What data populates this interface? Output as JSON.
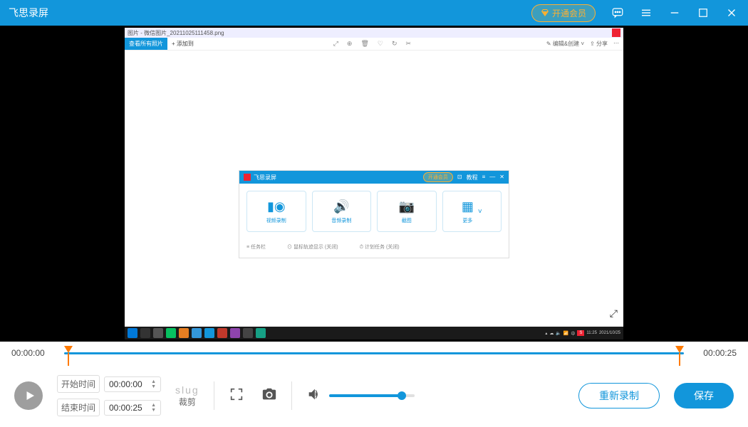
{
  "titlebar": {
    "title": "飞思录屏",
    "vip_label": "开通会员"
  },
  "video": {
    "file_title": "图片 - 微信图片_20211025111458.png",
    "tab1": "查看所有照片",
    "tab2": "+ 添加到",
    "right1": "编辑&创建",
    "right2": "分享",
    "taskbar": {
      "time": "11:25",
      "date": "2021/10/25"
    },
    "inner_app": {
      "title": "飞思录屏",
      "vip": "开通会员",
      "extra": "教程",
      "cards": {
        "c1": "视频录制",
        "c2": "音频录制",
        "c3": "截图",
        "c4": "更多"
      },
      "footer": {
        "f1": "任务栏",
        "f2": "鼠标轨迹显示 (关闭)",
        "f3": "计划任务 (关闭)"
      }
    }
  },
  "timeline": {
    "start": "00:00:00",
    "end": "00:00:25"
  },
  "controls": {
    "start_label": "开始时间",
    "start_value": "00:00:00",
    "end_label": "结束时间",
    "end_value": "00:00:25",
    "crop_label": "裁剪",
    "volume_percent": 85,
    "rerecord_label": "重新录制",
    "save_label": "保存"
  }
}
